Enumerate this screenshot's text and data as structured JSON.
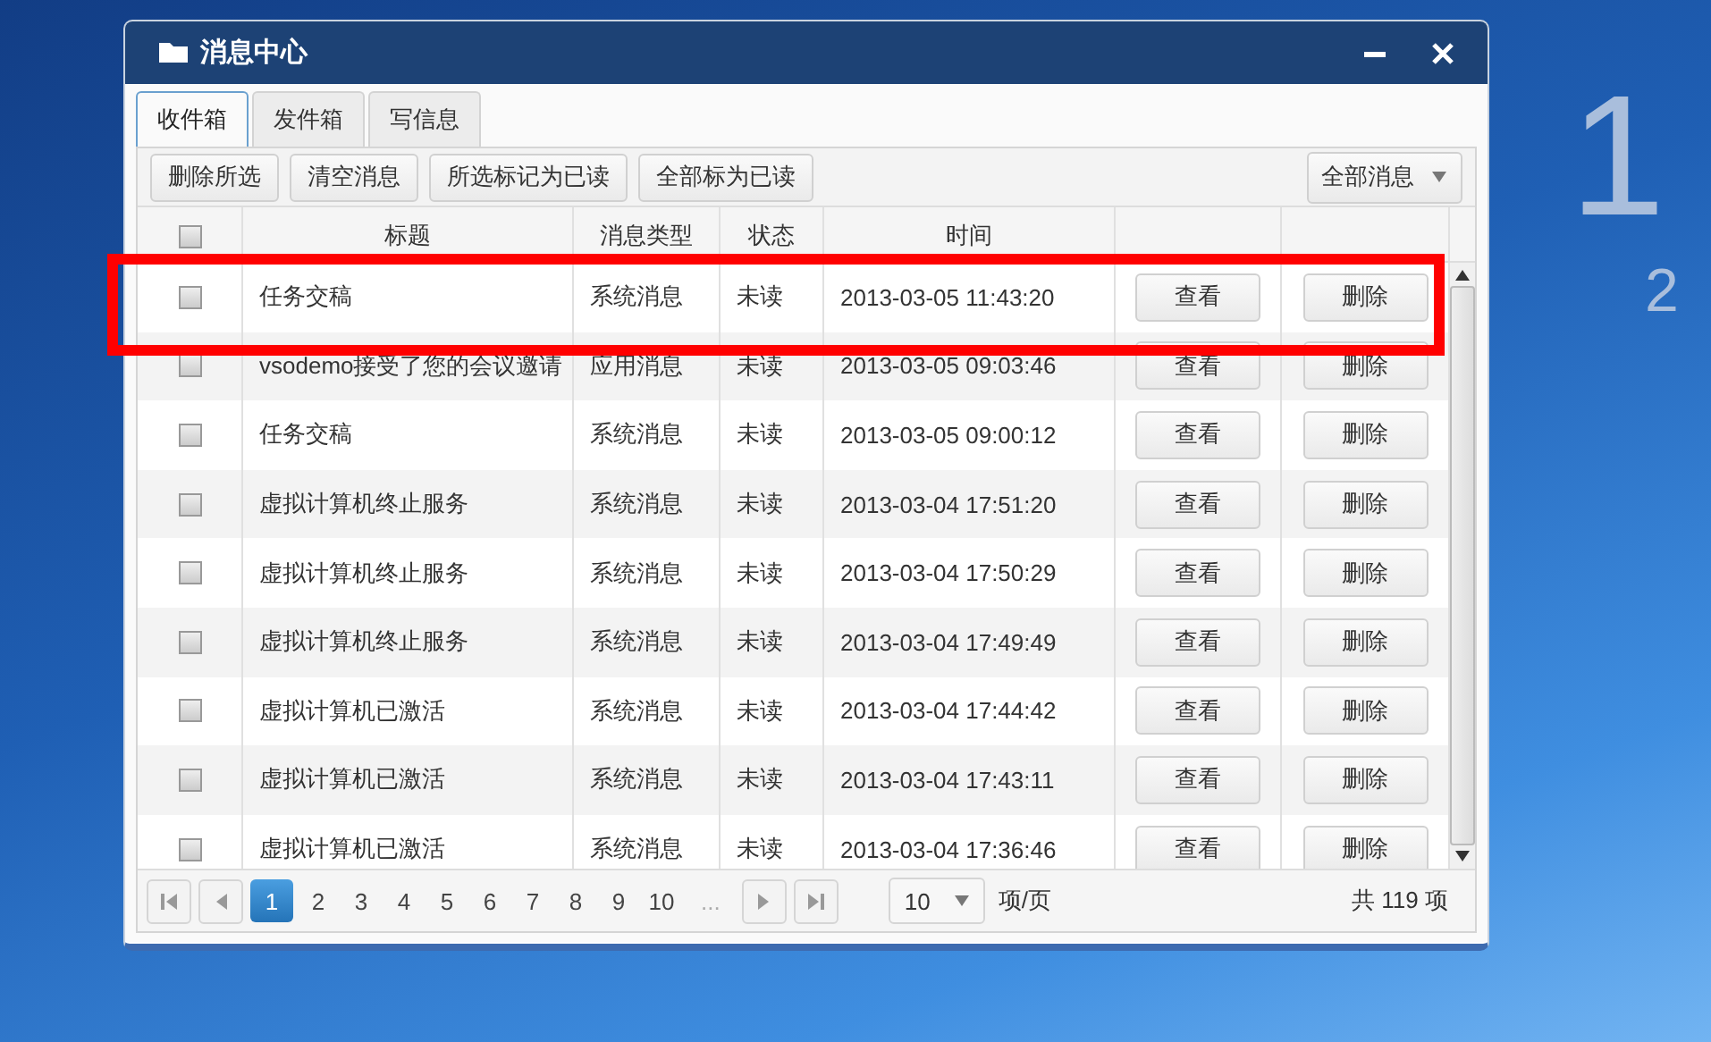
{
  "desktop": {
    "clock_hour": "1",
    "clock_year": "2"
  },
  "window": {
    "title": "消息中心"
  },
  "tabs": [
    {
      "label": "收件箱",
      "selected": true
    },
    {
      "label": "发件箱",
      "selected": false
    },
    {
      "label": "写信息",
      "selected": false
    }
  ],
  "toolbar": {
    "buttons": [
      "删除所选",
      "清空消息",
      "所选标记为已读",
      "全部标为已读"
    ],
    "filter": "全部消息"
  },
  "table": {
    "select_all_checked": false,
    "columns": [
      "标题",
      "消息类型",
      "状态",
      "时间"
    ],
    "rows": [
      {
        "checked": false,
        "highlighted": true,
        "title": "任务交稿",
        "type": "系统消息",
        "status": "未读",
        "time": "2013-03-05 11:43:20",
        "view": "查看",
        "delete": "删除"
      },
      {
        "checked": false,
        "highlighted": false,
        "title": "vsodemo接受了您的会议邀请",
        "type": "应用消息",
        "status": "未读",
        "time": "2013-03-05 09:03:46",
        "view": "查看",
        "delete": "删除"
      },
      {
        "checked": false,
        "highlighted": false,
        "title": "任务交稿",
        "type": "系统消息",
        "status": "未读",
        "time": "2013-03-05 09:00:12",
        "view": "查看",
        "delete": "删除"
      },
      {
        "checked": false,
        "highlighted": false,
        "title": "虚拟计算机终止服务",
        "type": "系统消息",
        "status": "未读",
        "time": "2013-03-04 17:51:20",
        "view": "查看",
        "delete": "删除"
      },
      {
        "checked": false,
        "highlighted": false,
        "title": "虚拟计算机终止服务",
        "type": "系统消息",
        "status": "未读",
        "time": "2013-03-04 17:50:29",
        "view": "查看",
        "delete": "删除"
      },
      {
        "checked": false,
        "highlighted": false,
        "title": "虚拟计算机终止服务",
        "type": "系统消息",
        "status": "未读",
        "time": "2013-03-04 17:49:49",
        "view": "查看",
        "delete": "删除"
      },
      {
        "checked": false,
        "highlighted": false,
        "title": "虚拟计算机已激活",
        "type": "系统消息",
        "status": "未读",
        "time": "2013-03-04 17:44:42",
        "view": "查看",
        "delete": "删除"
      },
      {
        "checked": false,
        "highlighted": false,
        "title": "虚拟计算机已激活",
        "type": "系统消息",
        "status": "未读",
        "time": "2013-03-04 17:43:11",
        "view": "查看",
        "delete": "删除"
      },
      {
        "checked": false,
        "highlighted": false,
        "title": "虚拟计算机已激活",
        "type": "系统消息",
        "status": "未读",
        "time": "2013-03-04 17:36:46",
        "view": "查看",
        "delete": "删除"
      }
    ]
  },
  "pager": {
    "pages": [
      {
        "label": "1",
        "selected": true
      },
      {
        "label": "2",
        "selected": false
      },
      {
        "label": "3",
        "selected": false
      },
      {
        "label": "4",
        "selected": false
      },
      {
        "label": "5",
        "selected": false
      },
      {
        "label": "6",
        "selected": false
      },
      {
        "label": "7",
        "selected": false
      },
      {
        "label": "8",
        "selected": false
      },
      {
        "label": "9",
        "selected": false
      },
      {
        "label": "10",
        "selected": false
      }
    ],
    "ellipsis": "...",
    "page_size": "10",
    "page_size_unit": "项/页",
    "total": "共 119 项"
  }
}
